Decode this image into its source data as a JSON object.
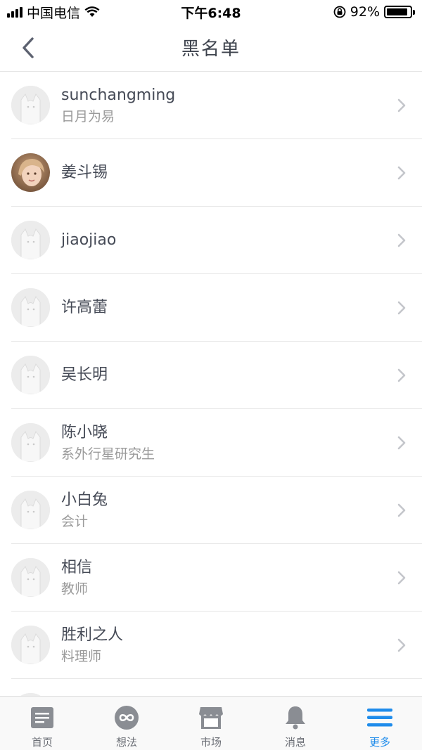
{
  "status_bar": {
    "carrier": "中国电信",
    "time": "下午6:48",
    "battery": "92%",
    "battery_level": 0.92
  },
  "nav": {
    "title": "黑名单",
    "back_icon": "chevron-left-icon"
  },
  "blacklist": [
    {
      "name": "sunchangming",
      "subtitle": "日月为易",
      "avatar": "default-avatar"
    },
    {
      "name": "姜斗锡",
      "subtitle": "",
      "avatar": "photo-avatar"
    },
    {
      "name": "jiaojiao",
      "subtitle": "",
      "avatar": "default-avatar"
    },
    {
      "name": "许高蕾",
      "subtitle": "",
      "avatar": "default-avatar"
    },
    {
      "name": "吴长明",
      "subtitle": "",
      "avatar": "default-avatar"
    },
    {
      "name": "陈小晓",
      "subtitle": "系外行星研究生",
      "avatar": "default-avatar"
    },
    {
      "name": "小白兔",
      "subtitle": "会计",
      "avatar": "default-avatar"
    },
    {
      "name": "相信",
      "subtitle": "教师",
      "avatar": "default-avatar"
    },
    {
      "name": "胜利之人",
      "subtitle": "料理师",
      "avatar": "default-avatar"
    }
  ],
  "tab_bar": {
    "tabs": [
      {
        "label": "首页",
        "icon": "document-icon",
        "active": false
      },
      {
        "label": "想法",
        "icon": "infinity-icon",
        "active": false
      },
      {
        "label": "市场",
        "icon": "store-icon",
        "active": false
      },
      {
        "label": "消息",
        "icon": "bell-icon",
        "active": false
      },
      {
        "label": "更多",
        "icon": "menu-icon",
        "active": true
      }
    ]
  },
  "colors": {
    "accent": "#1f8ceb",
    "inactive_icon": "#8a8d93",
    "text_primary": "#454a56",
    "text_secondary": "#9a9a9a"
  }
}
